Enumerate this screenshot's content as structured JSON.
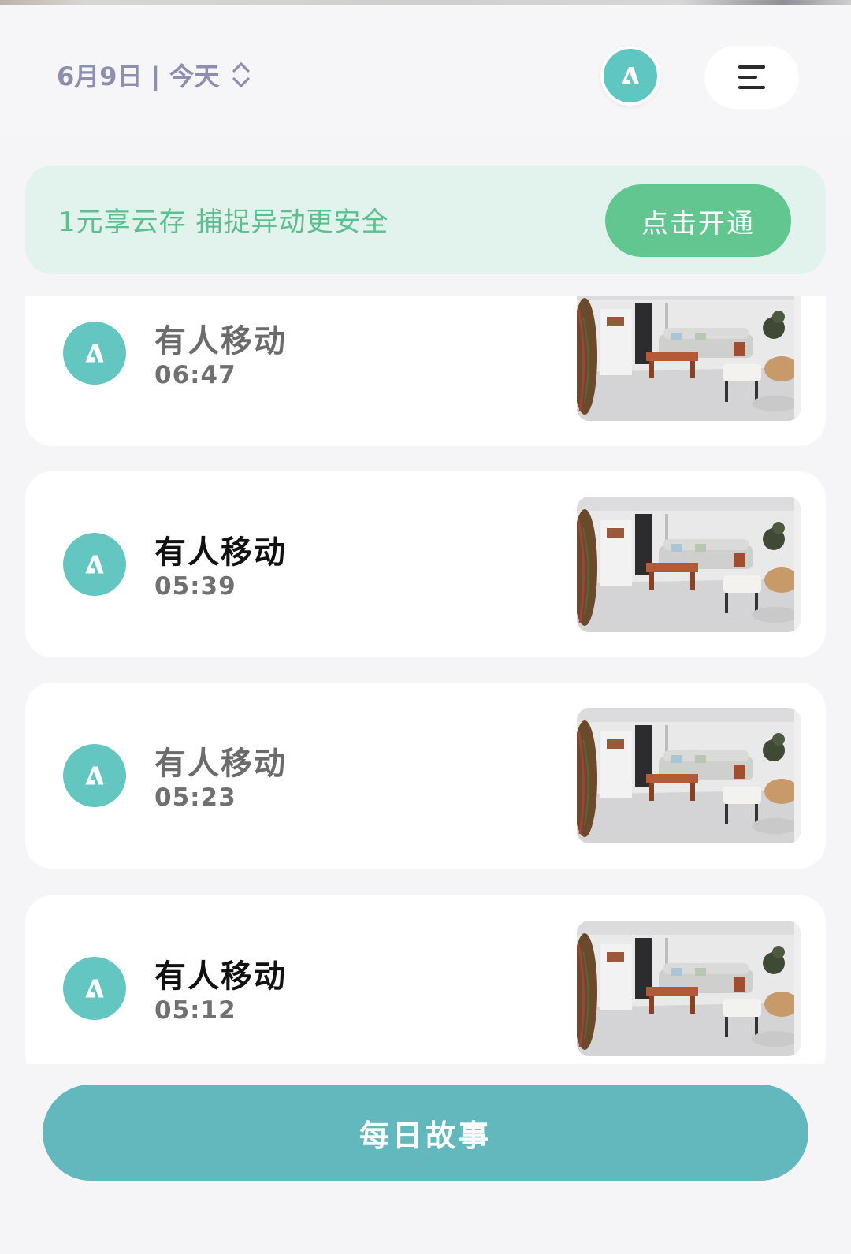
{
  "header": {
    "date_label": "6月9日 | 今天"
  },
  "promo": {
    "text": "1元享云存 捕捉异动更安全",
    "button_label": "点击开通"
  },
  "events": [
    {
      "title": "有人移动",
      "time": "06:47",
      "title_style": "dim"
    },
    {
      "title": "有人移动",
      "time": "05:39",
      "title_style": "bold"
    },
    {
      "title": "有人移动",
      "time": "05:23",
      "title_style": "dim"
    },
    {
      "title": "有人移动",
      "time": "05:12",
      "title_style": "bold"
    }
  ],
  "bottom": {
    "button_label": "每日故事"
  },
  "icons": {
    "date_toggle": "chevron-up-down-icon",
    "avatar": "brand-logo-icon",
    "menu": "menu-icon",
    "event": "person-motion-icon"
  },
  "colors": {
    "accent_teal": "#62b8bc",
    "icon_teal": "#64c6c1",
    "promo_green": "#62c691",
    "promo_bg": "#e2f2ec",
    "date_text": "#8c8fb0"
  }
}
